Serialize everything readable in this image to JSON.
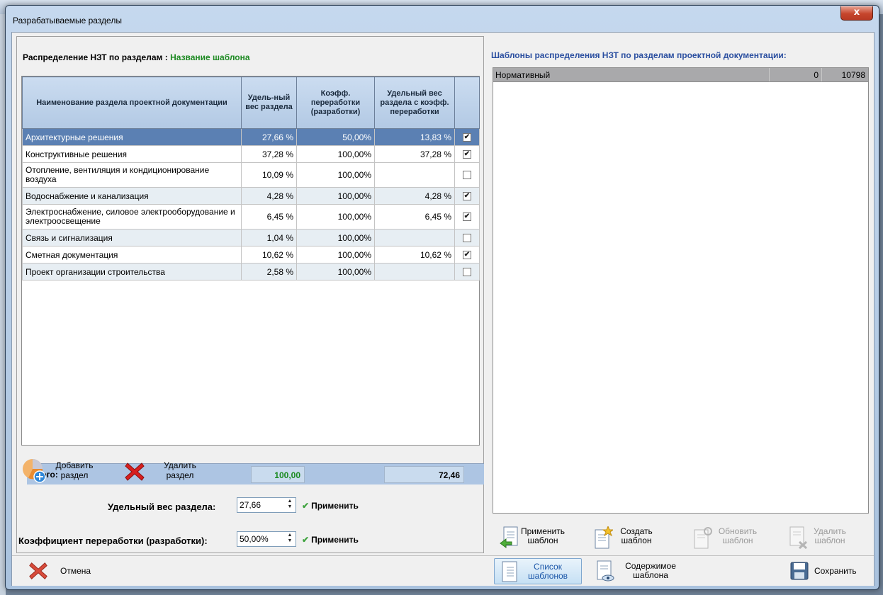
{
  "window": {
    "title": "Разрабатываемые разделы",
    "close_label": "x"
  },
  "distribution": {
    "label": "Распределение НЗТ по  разделам :",
    "template_name": "Название шаблона"
  },
  "grid": {
    "columns": [
      "Наименование раздела проектной документации",
      "Удель-ный вес раздела",
      "Коэфф. переработки (разработки)",
      "Удельный вес раздела с коэфф. переработки"
    ],
    "rows": [
      {
        "name": "Архитектурные решения",
        "weight": "27,66 %",
        "coef": "50,00%",
        "weighted": "13,83 %",
        "checked": true
      },
      {
        "name": "Конструктивные решения",
        "weight": "37,28 %",
        "coef": "100,00%",
        "weighted": "37,28 %",
        "checked": true
      },
      {
        "name": "Отопление, вентиляция и кондиционирование воздуха",
        "weight": "10,09 %",
        "coef": "100,00%",
        "weighted": "",
        "checked": false
      },
      {
        "name": "Водоснабжение и канализация",
        "weight": "4,28 %",
        "coef": "100,00%",
        "weighted": "4,28 %",
        "checked": true
      },
      {
        "name": "Электроснабжение, силовое электрооборудование и электроосвещение",
        "weight": "6,45 %",
        "coef": "100,00%",
        "weighted": "6,45 %",
        "checked": true
      },
      {
        "name": "Связь и сигнализация",
        "weight": "1,04 %",
        "coef": "100,00%",
        "weighted": "",
        "checked": false
      },
      {
        "name": "Сметная документация",
        "weight": "10,62 %",
        "coef": "100,00%",
        "weighted": "10,62 %",
        "checked": true
      },
      {
        "name": "Проект организации строительства",
        "weight": "2,58 %",
        "coef": "100,00%",
        "weighted": "",
        "checked": false
      }
    ],
    "totals": {
      "label": "Итого:",
      "weight": "100,00",
      "weighted": "72,46"
    }
  },
  "left_tools": {
    "add": "Добавить раздел",
    "remove": "Удалить раздел"
  },
  "fields": {
    "weight_label": "Удельный вес раздела:",
    "weight_value": "27,66",
    "coef_label": "Коэффициент переработки (разработки):",
    "coef_value": "50,00%",
    "apply": "Применить"
  },
  "templates": {
    "heading": "Шаблоны распределения НЗТ по разделам проектной документации:",
    "rows": [
      {
        "name": "Нормативный",
        "c2": "0",
        "c3": "10798"
      }
    ]
  },
  "right_tools": {
    "apply": "Применить шаблон",
    "create": "Создать шаблон",
    "update": "Обновить шаблон",
    "delete": "Удалить шаблон"
  },
  "bottom": {
    "cancel": "Отмена",
    "list": "Список шаблонов",
    "content": "Содержимое шаблона",
    "save": "Сохранить"
  },
  "colors": {
    "selected_row": "#5b80b3",
    "header": "#b2c9e4",
    "total_green": "#1a8a20",
    "heading_blue": "#2b4fa0"
  }
}
